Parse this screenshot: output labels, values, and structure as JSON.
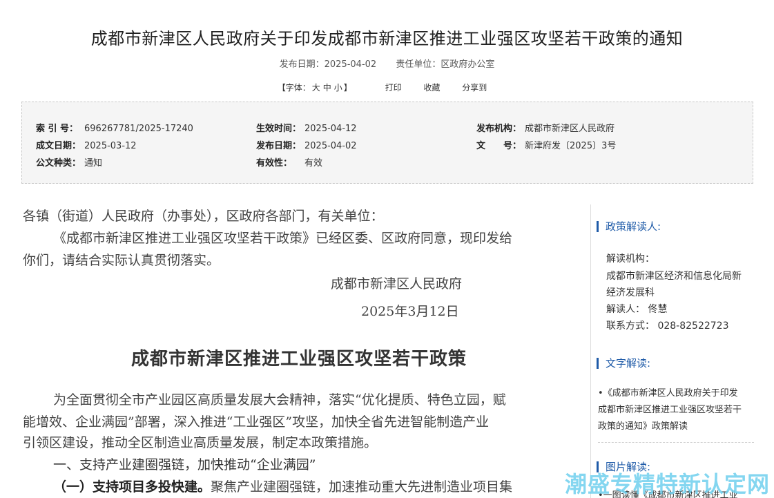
{
  "header": {
    "title": "成都市新津区人民政府关于印发成都市新津区推进工业强区攻坚若干政策的通知",
    "publish_date": "发布日期：2025-04-02",
    "unit": "责任单位：区政府办公室"
  },
  "tools": {
    "font_label": "【字体：",
    "size_large": "大",
    "size_medium": "中",
    "size_small": "小",
    "font_end": "】",
    "print": "打印",
    "favorite": "收藏",
    "share": "分享到"
  },
  "info": {
    "index_k": "索 引 号：",
    "index_v": "696267781/2025-17240",
    "effective_k": "生效时间：",
    "effective_v": "2025-04-12",
    "org_k": "发布机构：",
    "org_v": "成都市新津区人民政府",
    "written_k": "成文日期：",
    "written_v": "2025-03-12",
    "pubdate_k": "发布日期：",
    "pubdate_v": "2025-04-02",
    "docno_k": "文　　号：",
    "docno_v": "新津府发〔2025〕3号",
    "type_k": "公文种类：",
    "type_v": "通知",
    "validity_k": "有效性：",
    "validity_v": "有效"
  },
  "content": {
    "salutation": "各镇（街道）人民政府（办事处），区政府各部门，有关单位：",
    "para1_l1": "《成都市新津区推进工业强区攻坚若干政策》已经区委、区政府同意，现印发给",
    "para1_l2": "你们，请结合实际认真贯彻落实。",
    "signer": "成都市新津区人民政府",
    "date": "2025年3月12日",
    "policy_title": "成都市新津区推进工业强区攻坚若干政策",
    "intro_l1": "为全面贯彻全市产业园区高质量发展大会精神，落实“优化提质、特色立园，赋",
    "intro_l2": "能增效、企业满园”部署，深入推进“工业强区”攻坚，加快全省先进智能制造产业",
    "intro_l3": "引领区建设，推动全区制造业高质量发展，制定本政策措施。",
    "section1": "一、支持产业建圈强链，加快推动“企业满园”",
    "item1_bold": "（一）支持项目多投快建。",
    "item1_text": "聚焦产业建圈强链，加速推动重大先进制造业项目集"
  },
  "sidebar": {
    "reader_head": "政策解读人:",
    "org_label": "解读机构：",
    "org_line1": "成都市新津区经济和信息化局新",
    "org_line2": "经济发展科",
    "person": "解读人：  佟慧",
    "contact": "联系方式：  028-82522723",
    "text_head": "文字解读:",
    "text_l1": "•《成都市新津区人民政府关于印发",
    "text_l2": "成都市新津区推进工业强区攻坚若干",
    "text_l3": "政策的通知》政策解读",
    "image_head": "图片解读:",
    "image_l1": "•一图读懂《成都市新津区推进工业"
  },
  "watermark": "潮盛专精特新认定网",
  "colors": {
    "accent": "#1f5ba8",
    "watermark": "#6fd0ee",
    "infobox_bg": "#f5f5f5"
  }
}
